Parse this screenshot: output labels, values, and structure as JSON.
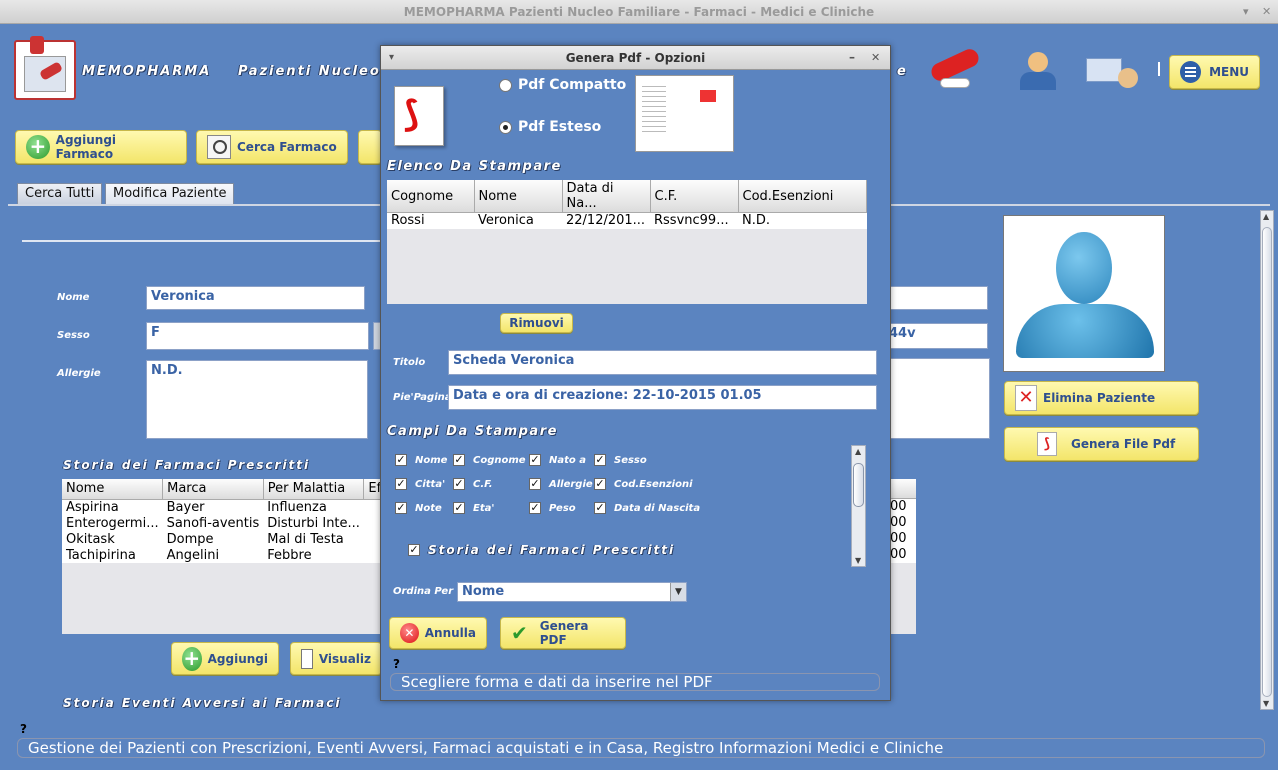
{
  "window": {
    "title": "MEMOPHARMA    Pazienti Nucleo Familiare - Farmaci - Medici e Cliniche"
  },
  "header": {
    "app_name": "MEMOPHARMA",
    "section": "Pazienti Nucleo",
    "section_tail": "e",
    "menu_label": "MENU"
  },
  "toolbar": {
    "add_drug": "Aggiungi Farmaco",
    "search_drug": "Cerca Farmaco"
  },
  "tabs": [
    {
      "label": "Cerca Tutti"
    },
    {
      "label": "Modifica Paziente"
    }
  ],
  "form": {
    "name_label": "Nome",
    "name_value": "Veronica",
    "sex_label": "Sesso",
    "sex_value": "F",
    "allergies_label": "Allergie",
    "allergies_value": "N.D.",
    "cf_tail": "44v"
  },
  "drug_history": {
    "title": "Storia dei Farmaci Prescritti",
    "columns": [
      "Nome",
      "Marca",
      "Per Malattia",
      "Ef"
    ],
    "rows": [
      [
        "Aspirina",
        "Bayer",
        "Influenza"
      ],
      [
        "Enterogermi...",
        "Sanofi-aventis",
        "Disturbi Inte..."
      ],
      [
        "Okitask",
        "Dompe",
        "Mal di Testa"
      ],
      [
        "Tachipirina",
        "Angelini",
        "Febbre"
      ]
    ],
    "right_values": [
      "00",
      "00",
      "00",
      "00"
    ],
    "add_label": "Aggiungi",
    "view_label": "Visualiz"
  },
  "adverse_title": "Storia Eventi Avversi ai Farmaci",
  "side": {
    "delete_patient": "Elimina Paziente",
    "generate_pdf": "Genera File Pdf"
  },
  "status": {
    "help": "?",
    "text": "Gestione dei Pazienti con Prescrizioni, Eventi Avversi, Farmaci acquistati e in Casa, Registro Informazioni Medici e Cliniche"
  },
  "dialog": {
    "title": "Genera Pdf - Opzioni",
    "radio_compact": "Pdf Compatto",
    "radio_extended": "Pdf Esteso",
    "list_title": "Elenco Da Stampare",
    "list_columns": [
      "Cognome",
      "Nome",
      "Data di Na...",
      "C.F.",
      "Cod.Esenzioni"
    ],
    "list_rows": [
      [
        "Rossi",
        "Veronica",
        "22/12/201...",
        "Rssvnc99...",
        "N.D."
      ]
    ],
    "remove_label": "Rimuovi",
    "titolo_label": "Titolo",
    "titolo_value": "Scheda Veronica",
    "footer_label": "Pie'Pagina",
    "footer_value": "Data e ora di creazione: 22-10-2015 01.05",
    "fields_title": "Campi Da Stampare",
    "fields": [
      [
        "Nome",
        "Cognome",
        "Nato a",
        "Sesso"
      ],
      [
        "Citta'",
        "C.F.",
        "Allergie",
        "Cod.Esenzioni"
      ],
      [
        "Note",
        "Eta'",
        "Peso",
        "Data di Nascita"
      ]
    ],
    "history_check": "Storia dei Farmaci Prescritti",
    "order_label": "Ordina Per",
    "order_value": "Nome",
    "cancel_label": "Annulla",
    "generate_label": "Genera PDF",
    "help": "?",
    "hint": "Scegliere forma e dati da inserire nel PDF"
  }
}
